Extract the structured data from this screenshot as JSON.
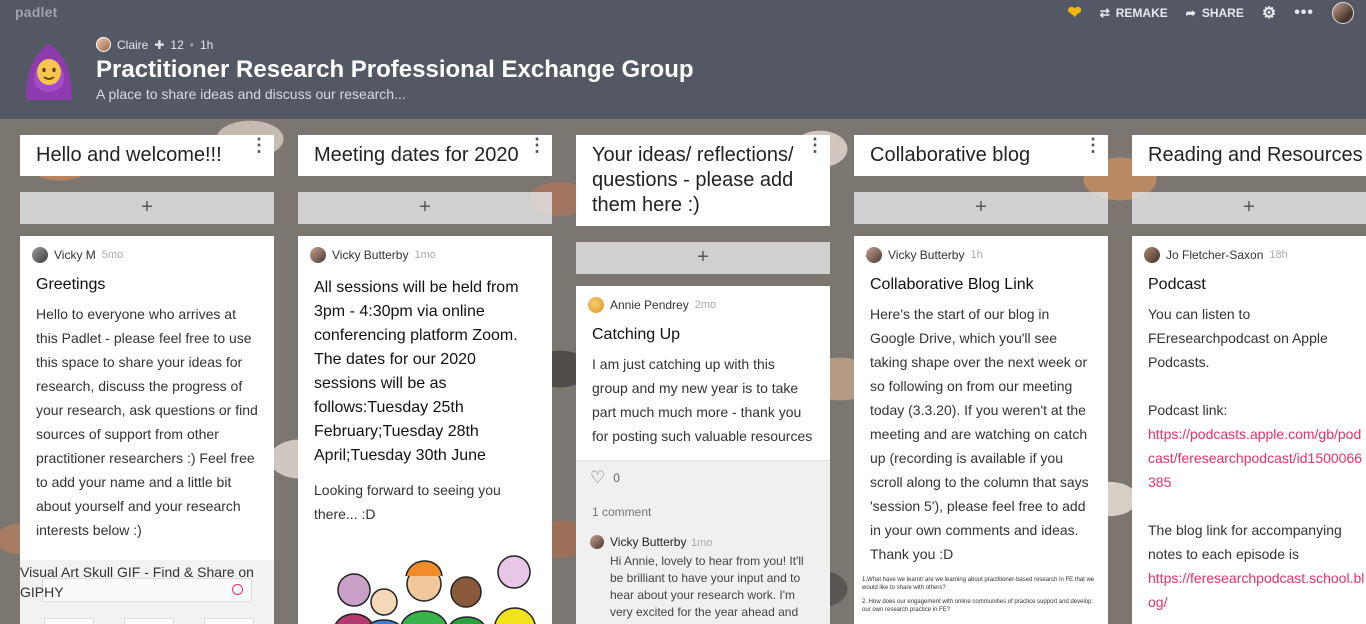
{
  "brand": "padlet",
  "toolbar": {
    "remake": "REMAKE",
    "share": "SHARE"
  },
  "header": {
    "author": "Claire",
    "plus_count": "12",
    "age": "1h",
    "title": "Practitioner Research Professional Exchange Group",
    "subtitle": "A place to share ideas and discuss our research..."
  },
  "columns": [
    {
      "title": "Hello and welcome!!!"
    },
    {
      "title": "Meeting dates for 2020"
    },
    {
      "title": "Your ideas/ reflections/ questions - please add them here :)"
    },
    {
      "title": "Collaborative blog"
    },
    {
      "title": "Reading and Resources"
    }
  ],
  "add_symbol": "+",
  "cards": {
    "c1": {
      "author": "Vicky M",
      "time": "5mo",
      "title": "Greetings",
      "body": "Hello to everyone who arrives at this Padlet - please feel free to use this space to share your ideas for research, discuss the progress of your research, ask questions or find sources of support from other practitioner researchers :) Feel free to add your name and a little bit about yourself and your research interests below :)",
      "gif_alt": "Visual Art Skull GIF - Find & Share on GIPHY"
    },
    "c2": {
      "author": "Vicky Butterby",
      "time": "1mo",
      "body_big": "All sessions will be held from 3pm - 4:30pm via online conferencing platform Zoom. The dates for our 2020 sessions will be as follows:Tuesday 25th February;Tuesday 28th April;Tuesday 30th June",
      "body": "Looking forward to seeing you there... :D"
    },
    "c3": {
      "author": "Annie Pendrey",
      "time": "2mo",
      "title": "Catching Up",
      "body": "I am just catching up with this group and my new year is to take part much much more - thank you for posting such valuable resources",
      "likes": "0",
      "comment_count": "1 comment",
      "comment": {
        "author": "Vicky Butterby",
        "time": "1mo",
        "text": "Hi Annie, lovely to hear from you! It'll be brilliant to have your input and to hear about your research work. I'm very excited for the year ahead and"
      }
    },
    "c4": {
      "author": "Vicky Butterby",
      "time": "1h",
      "title": "Collaborative Blog Link",
      "body": "Here's the start of our blog in Google Drive, which you'll see taking shape over the next week or so following on from our meeting today (3.3.20). If you weren't at the meeting and are watching on catch up (recording is available if you scroll along to the column that says 'session 5'), please feel free to add in your own comments and ideas. Thank you :D",
      "doc_line1": "1.What have we learnt/ are we learning about practitioner-based research in FE that we would like to share with others?",
      "doc_line2": "2. How does our engagement with online communities of practice support and develop our own research practice in FE?"
    },
    "c5": {
      "author": "Jo Fletcher-Saxon",
      "time": "18h",
      "title": "Podcast",
      "body1": "You can listen to FEresearchpodcast on Apple Podcasts.",
      "body2": "Podcast link:",
      "link1": "https://podcasts.apple.com/gb/podcast/feresearchpodcast/id1500066385",
      "body3": "The blog link for accompanying notes to each episode is",
      "link2": "https://feresearchpodcast.school.blog/"
    }
  },
  "colors": {
    "header_bg": "#545865",
    "accent_link": "#e3316b",
    "heart": "#f2b705"
  }
}
